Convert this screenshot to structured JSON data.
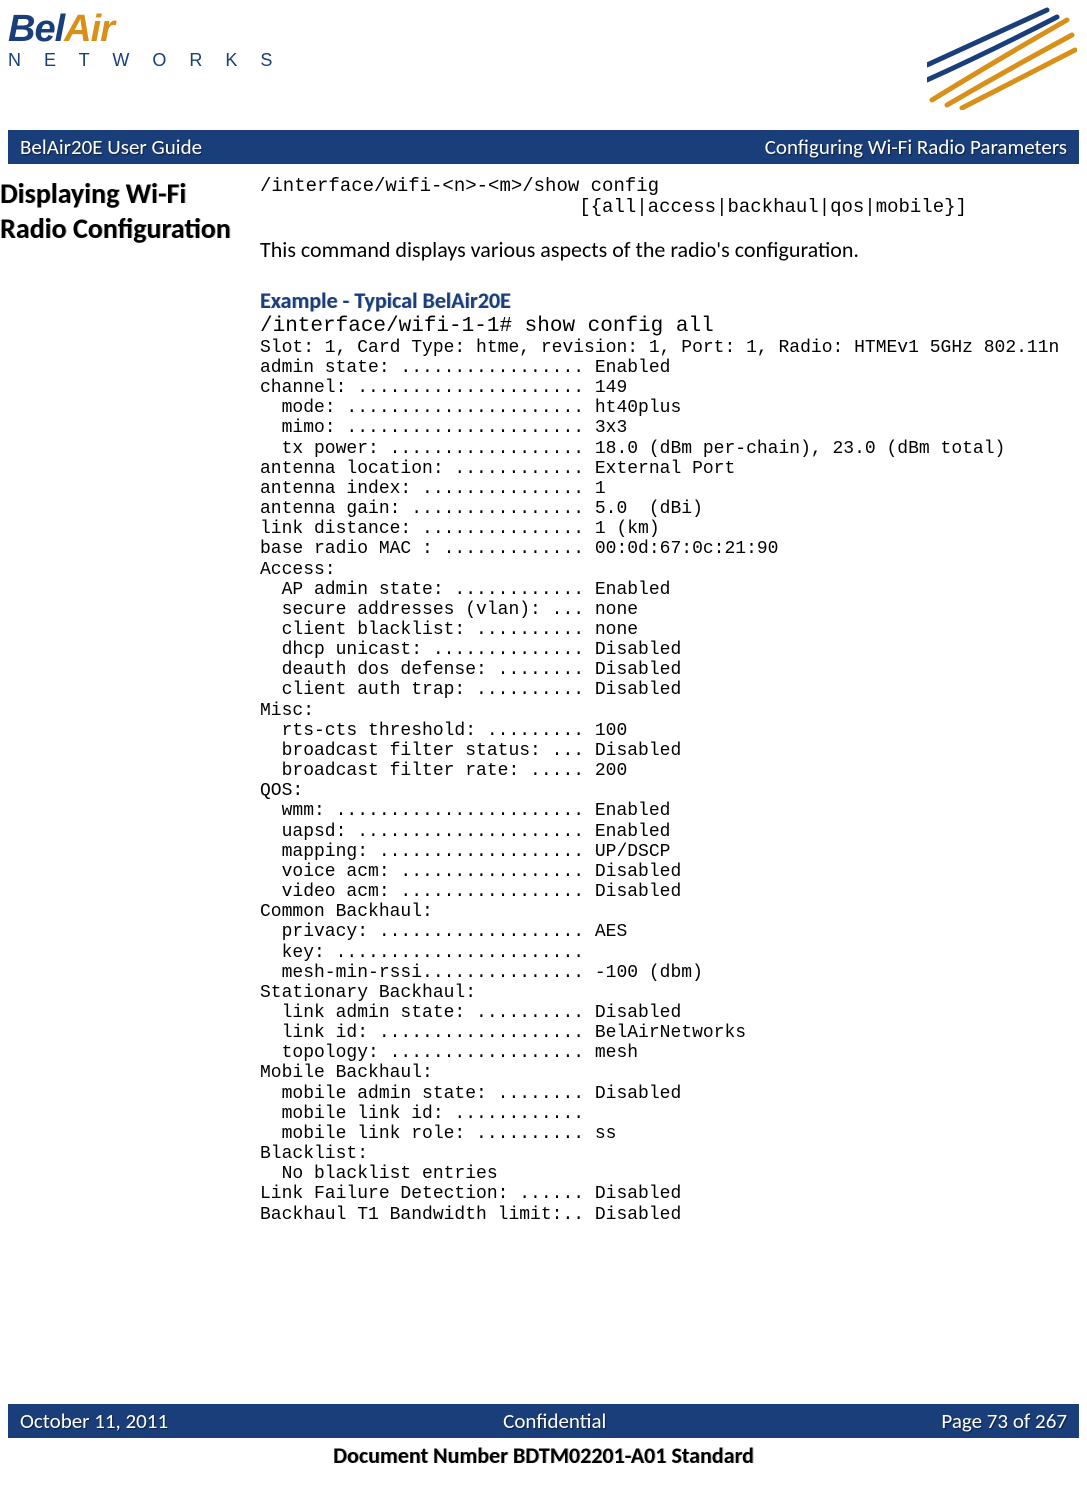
{
  "header": {
    "logo_main_1": "Bel",
    "logo_main_2": "Air",
    "logo_sub": "N E T W O R K S"
  },
  "titlebar": {
    "left": "BelAir20E User Guide",
    "right": "Configuring Wi-Fi Radio Parameters"
  },
  "section": {
    "heading": "Displaying Wi-Fi Radio Configuration",
    "syntax": "/interface/wifi-<n>-<m>/show config\n                            [{all|access|backhaul|qos|mobile}]",
    "description": "This command displays various aspects of the radio's configuration.",
    "example_heading": "Example - Typical BelAir20E",
    "example_cmd": "/interface/wifi-1-1# show config all",
    "example_output": "Slot: 1, Card Type: htme, revision: 1, Port: 1, Radio: HTMEv1 5GHz 802.11n\nadmin state: ................. Enabled\nchannel: ..................... 149\n  mode: ...................... ht40plus\n  mimo: ...................... 3x3\n  tx power: .................. 18.0 (dBm per-chain), 23.0 (dBm total)\nantenna location: ............ External Port\nantenna index: ............... 1\nantenna gain: ................ 5.0  (dBi)\nlink distance: ............... 1 (km)\nbase radio MAC : ............. 00:0d:67:0c:21:90\nAccess:\n  AP admin state: ............ Enabled\n  secure addresses (vlan): ... none\n  client blacklist: .......... none\n  dhcp unicast: .............. Disabled\n  deauth dos defense: ........ Disabled\n  client auth trap: .......... Disabled\nMisc:\n  rts-cts threshold: ......... 100\n  broadcast filter status: ... Disabled\n  broadcast filter rate: ..... 200\nQOS:\n  wmm: ....................... Enabled\n  uapsd: ..................... Enabled\n  mapping: ................... UP/DSCP\n  voice acm: ................. Disabled\n  video acm: ................. Disabled\nCommon Backhaul:\n  privacy: ................... AES\n  key: ....................... \n  mesh-min-rssi............... -100 (dbm)\nStationary Backhaul:\n  link admin state: .......... Disabled\n  link id: ................... BelAirNetworks\n  topology: .................. mesh\nMobile Backhaul:\n  mobile admin state: ........ Disabled\n  mobile link id: ............ \n  mobile link role: .......... ss\nBlacklist:\n  No blacklist entries\nLink Failure Detection: ...... Disabled\nBackhaul T1 Bandwidth limit:.. Disabled"
  },
  "footer": {
    "left": "October 11, 2011",
    "center": "Confidential",
    "right": "Page 73 of 267",
    "docnum": "Document Number BDTM02201-A01 Standard"
  }
}
